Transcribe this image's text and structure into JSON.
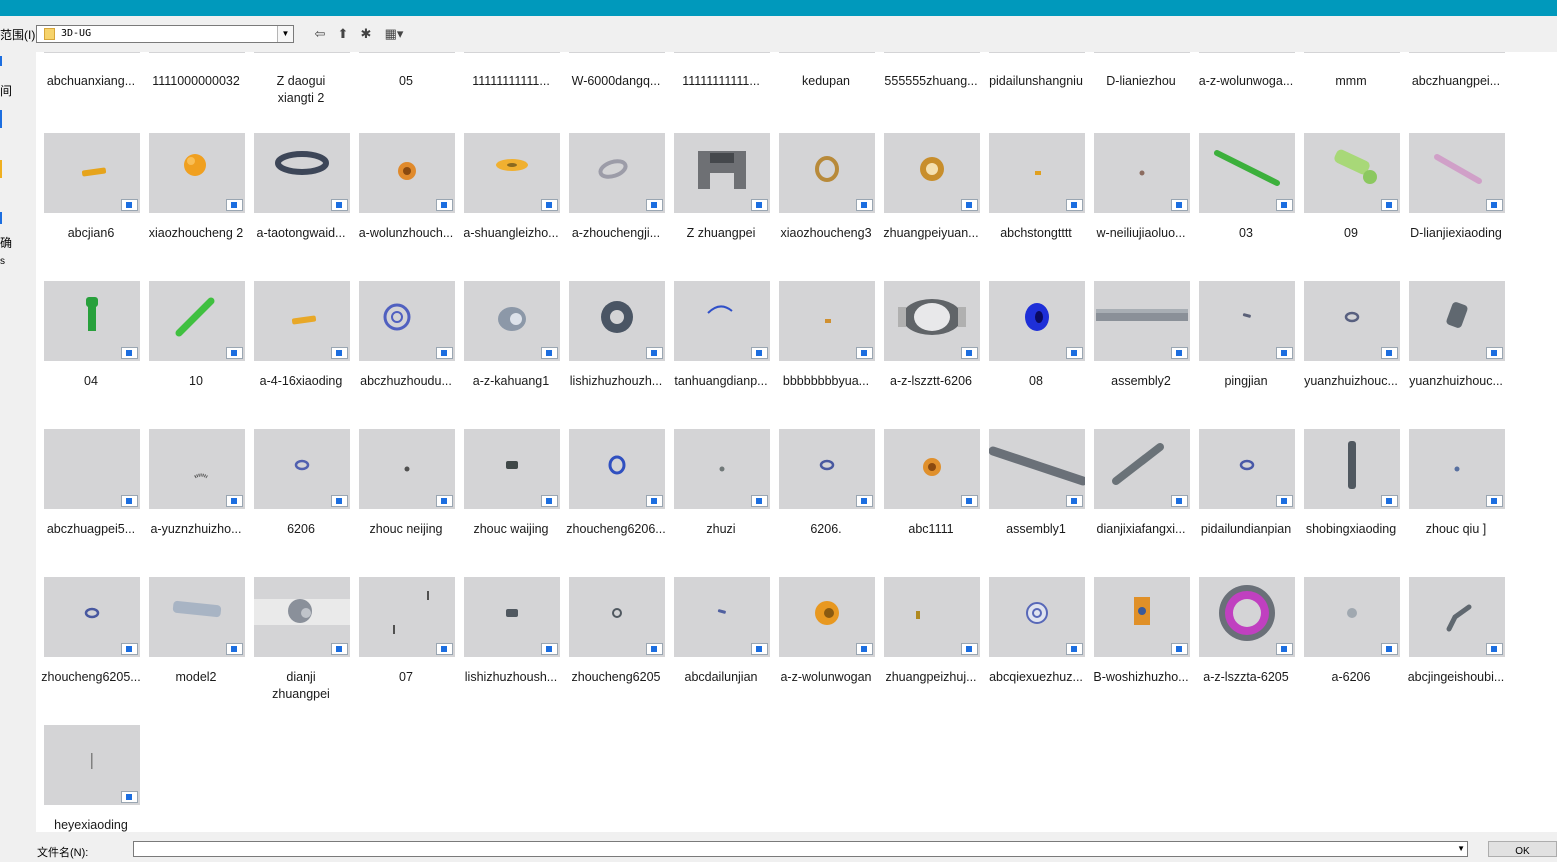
{
  "toolbar": {
    "lookin_label": "范围(I):",
    "folder_value": "3D-UG",
    "dropdown_arrow": "▼",
    "back_glyph": "⇦",
    "up_glyph": "⬆",
    "newfolder_glyph": "✱",
    "view_glyph": "▦▾"
  },
  "sidebar": {
    "texts": [
      "间",
      "确",
      "s"
    ]
  },
  "files": {
    "row0": [
      {
        "label": "abchuanxiang..."
      },
      {
        "label": "1111000000032"
      },
      {
        "label": "Z  daogui\nxiangti 2"
      },
      {
        "label": "05"
      },
      {
        "label": "11111111111..."
      },
      {
        "label": "W-6000dangq..."
      },
      {
        "label": "11111111111..."
      },
      {
        "label": "kedupan"
      },
      {
        "label": "555555zhuang..."
      },
      {
        "label": "pidailunshangniu"
      },
      {
        "label": "D-lianiezhou"
      },
      {
        "label": "a-z-wolunwoga..."
      },
      {
        "label": "mmm"
      },
      {
        "label": "abczhuangpei..."
      }
    ],
    "row1": [
      {
        "label": "abcjian6",
        "icon": "orange-pin-icon",
        "color": "#e6a41c"
      },
      {
        "label": "xiaozhoucheng 2",
        "icon": "orange-ball-icon",
        "color": "#f0a020"
      },
      {
        "label": "a-taotongwaid...",
        "icon": "dark-ring-icon",
        "color": "#3d4658"
      },
      {
        "label": "a-wolunzhouch...",
        "icon": "orange-bearing-icon",
        "color": "#e08a2c"
      },
      {
        "label": "a-shuangleizho...",
        "icon": "orange-washer-icon",
        "color": "#f0b030"
      },
      {
        "label": "a-zhouchengji...",
        "icon": "gray-ring-icon",
        "color": "#9c9ca8"
      },
      {
        "label": "Z   zhuangpei",
        "icon": "gray-frame-icon",
        "color": "#6e7074"
      },
      {
        "label": "xiaozhoucheng3",
        "icon": "gold-ring-icon",
        "color": "#b88a3a"
      },
      {
        "label": "zhuangpeiyuan...",
        "icon": "gold-gear-icon",
        "color": "#c88e2c"
      },
      {
        "label": "abchstongtttt",
        "icon": "tiny-dot-icon",
        "color": "#e0a020"
      },
      {
        "label": "w-neiliujiaoluo...",
        "icon": "small-dot-icon",
        "color": "#8c6c60"
      },
      {
        "label": "03",
        "icon": "green-rod-icon",
        "color": "#3cb03c"
      },
      {
        "label": "09",
        "icon": "green-bolt-icon",
        "color": "#a8d878"
      },
      {
        "label": "D-lianjiexiaoding",
        "icon": "pink-rod-icon",
        "color": "#d0a0c8"
      }
    ],
    "row2": [
      {
        "label": "04",
        "icon": "green-screw-icon",
        "color": "#28a03c"
      },
      {
        "label": "10",
        "icon": "green-shaft-icon",
        "color": "#40c040"
      },
      {
        "label": "a-4-16xiaoding",
        "icon": "orange-pin-icon",
        "color": "#e8a828"
      },
      {
        "label": "abczhuzhoudu...",
        "icon": "blue-gear-icon",
        "color": "#5060c0"
      },
      {
        "label": "a-z-kahuang1",
        "icon": "gray-coupling-icon",
        "color": "#8c98a8"
      },
      {
        "label": "lishizhuzhouzh...",
        "icon": "dark-washer-icon",
        "color": "#4a5564"
      },
      {
        "label": "tanhuangdianp...",
        "icon": "blue-arc-icon",
        "color": "#3050c8"
      },
      {
        "label": "bbbbbbbbyua...",
        "icon": "tiny-dot-icon",
        "color": "#d09030"
      },
      {
        "label": "a-z-lszztt-6206",
        "icon": "bearing-cage-icon",
        "color": "#606468"
      },
      {
        "label": "08",
        "icon": "blue-pulley-icon",
        "color": "#1e2fd8"
      },
      {
        "label": "assembly2",
        "icon": "gray-beam-icon",
        "color": "#8a9098"
      },
      {
        "label": "pingjian",
        "icon": "small-key-icon",
        "color": "#5a6078"
      },
      {
        "label": "yuanzhuizhouc...",
        "icon": "small-ring-icon",
        "color": "#586080"
      },
      {
        "label": "yuanzhuizhouc...",
        "icon": "gray-cylinder-icon",
        "color": "#606870"
      }
    ],
    "row3": [
      {
        "label": "abczhuagpei5...",
        "icon": "blank-icon",
        "color": "#d4d4d6"
      },
      {
        "label": "a-yuznzhuizho...",
        "icon": "tiny-rollers-icon",
        "color": "#505050"
      },
      {
        "label": "6206",
        "icon": "small-ring-icon",
        "color": "#5060b0"
      },
      {
        "label": "zhouc    neijing",
        "icon": "small-dot-icon",
        "color": "#505050"
      },
      {
        "label": "zhouc    waijing",
        "icon": "small-coupling-icon",
        "color": "#404848"
      },
      {
        "label": "zhoucheng6206...",
        "icon": "blue-ring-icon",
        "color": "#3050c0"
      },
      {
        "label": "zhuzi",
        "icon": "small-dot-icon",
        "color": "#707878"
      },
      {
        "label": "6206.",
        "icon": "small-ring-icon",
        "color": "#4858a0"
      },
      {
        "label": "abc1111",
        "icon": "orange-bearing-icon",
        "color": "#e0902c"
      },
      {
        "label": "assembly1",
        "icon": "long-shaft-icon",
        "color": "#6a7078"
      },
      {
        "label": "dianjixiafangxi...",
        "icon": "gray-rod-icon",
        "color": "#6a7278"
      },
      {
        "label": "pidailundianpian",
        "icon": "small-ring-icon",
        "color": "#4858a8"
      },
      {
        "label": "shobingxiaoding",
        "icon": "vertical-pin-icon",
        "color": "#505860"
      },
      {
        "label": "zhouc    qiu ]",
        "icon": "small-dot-icon",
        "color": "#5870a0"
      }
    ],
    "row4": [
      {
        "label": "zhoucheng6205...",
        "icon": "small-ring-icon",
        "color": "#4858a0"
      },
      {
        "label": "model2",
        "icon": "roller-icon",
        "color": "#a8b4c4"
      },
      {
        "label": "dianji\nzhuangpei",
        "icon": "motor-icon",
        "color": "#8a909a"
      },
      {
        "label": "07",
        "icon": "two-ticks-icon",
        "color": "#505050"
      },
      {
        "label": "lishizhuzhoush...",
        "icon": "small-coupling-icon",
        "color": "#505860"
      },
      {
        "label": "zhoucheng6205",
        "icon": "tiny-ring-icon",
        "color": "#505860"
      },
      {
        "label": "abcdailunjian",
        "icon": "small-key-icon",
        "color": "#5060a0"
      },
      {
        "label": "a-z-wolunwogan",
        "icon": "orange-housing-icon",
        "color": "#e89820"
      },
      {
        "label": "zhuangpeizhuj...",
        "icon": "tiny-gold-icon",
        "color": "#b08a20"
      },
      {
        "label": "abcqiexuezhuz...",
        "icon": "blue-flange-icon",
        "color": "#5868b8"
      },
      {
        "label": "B-woshizhuzho...",
        "icon": "orange-block-icon",
        "color": "#e09028"
      },
      {
        "label": "a-z-lszzta-6205",
        "icon": "magenta-bearing-icon",
        "color": "#c040c0"
      },
      {
        "label": "a-6206",
        "icon": "gray-ball-icon",
        "color": "#a0a8b0"
      },
      {
        "label": "abcjingeishoubi...",
        "icon": "gray-elbow-icon",
        "color": "#606870"
      }
    ],
    "row5": [
      {
        "label": "heyexiaoding",
        "icon": "thin-line-icon",
        "color": "#808080"
      }
    ]
  },
  "bottom": {
    "filename_label": "文件名(N):",
    "filename_value": "",
    "ok_label": "OK",
    "dropdown_arrow": "▼"
  }
}
